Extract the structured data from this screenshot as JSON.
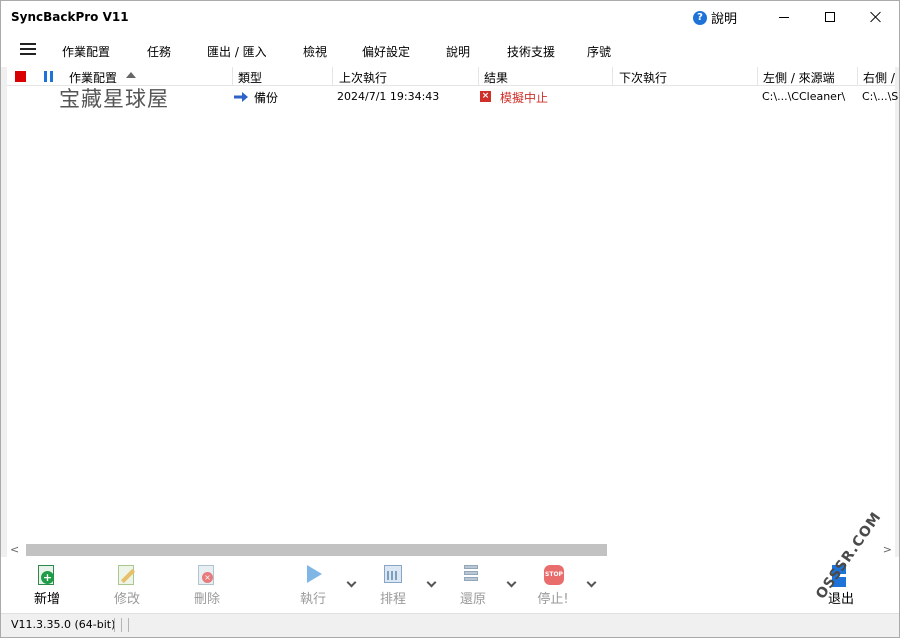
{
  "window": {
    "title": "SyncBackPro V11",
    "help_label": "說明"
  },
  "menu": {
    "items": [
      "作業配置",
      "任務",
      "匯出 / 匯入",
      "檢視",
      "偏好設定",
      "說明",
      "技術支援",
      "序號"
    ]
  },
  "list": {
    "columns": [
      "作業配置",
      "類型",
      "上次執行",
      "結果",
      "下次執行",
      "左側 / 來源端",
      "右側 /"
    ],
    "rows": [
      {
        "name": "",
        "type": "備份",
        "last_run": "2024/7/1 19:34:43",
        "result": "模擬中止",
        "next_run": "",
        "left_source": "C:\\...\\CCleaner\\",
        "right": "C:\\...\\S"
      }
    ]
  },
  "watermark_text": "宝藏星球屋",
  "toolbar": {
    "new": "新增",
    "modify": "修改",
    "delete": "刪除",
    "run": "執行",
    "schedule": "排程",
    "restore": "還原",
    "stop": "停止!",
    "exit": "退出"
  },
  "icons": {
    "stop_square": "stop-square-icon",
    "pause": "pause-icon",
    "sort": "sort-ascending-icon",
    "type_arrow": "right-arrow-icon",
    "result_error": "error-x-icon",
    "stop_badge_text": "STOP"
  },
  "status": {
    "version": "V11.3.35.0 (64-bit)"
  },
  "site_watermark": "OSSSR.COM",
  "colors": {
    "accent": "#1e73d8",
    "error": "#d0302a",
    "stop": "#d80000"
  }
}
